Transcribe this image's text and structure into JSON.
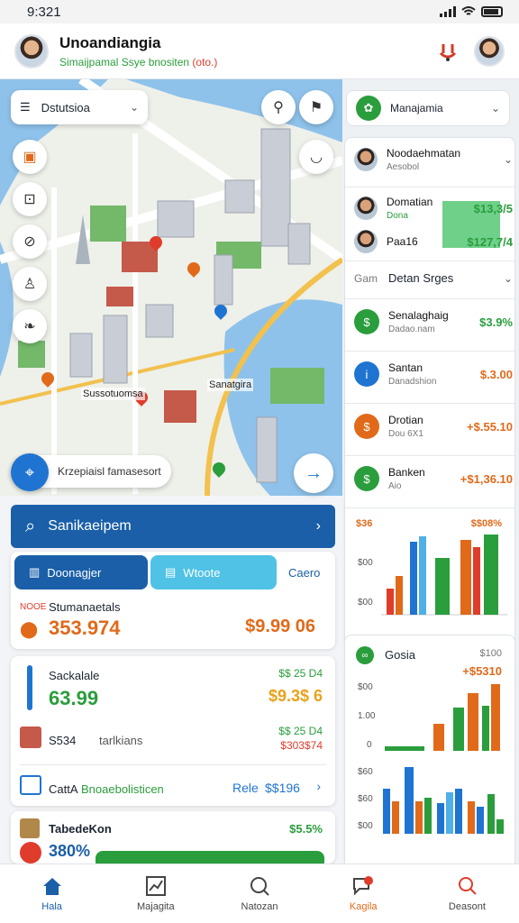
{
  "status": {
    "time": "9:321"
  },
  "header": {
    "title": "Unoandiangia",
    "subtitle": "Simaijpamal Ssye bnositen",
    "subtitle_tag": "(oto.)"
  },
  "map": {
    "dropdown_label": "Dstutsioa",
    "label_left": "Sussotuomsa",
    "label_right": "Sanatgira",
    "bottom_text": "Krzepiaisl famasesort"
  },
  "right_panel": {
    "card1_title": "Manajamia",
    "contact_main": {
      "name": "Noodaehmatan",
      "sub": "Aesobol"
    },
    "contacts": [
      {
        "name": "Domatian",
        "sub": "Dona",
        "value": "$13,3/5"
      },
      {
        "name": "Paa16",
        "sub": "",
        "value": "$127,7/4"
      }
    ],
    "section_prefix": "Gam",
    "section_title": "Detan Srges",
    "list": [
      {
        "name": "Senalaghaig",
        "sub": "Dadao.nam",
        "value": "$3.9%",
        "color": "#2a9d3c"
      },
      {
        "name": "Santan",
        "sub": "Danadshion",
        "value": "$.3.00",
        "color": "#1f74d1"
      },
      {
        "name": "Drotian",
        "sub": "Dou 6X1",
        "value": "+$.55.10",
        "color": "#e06a1a"
      },
      {
        "name": "Banken",
        "sub": "Aio",
        "value": "+$1,36.10",
        "color": "#2a9d3c"
      }
    ],
    "chart1": {
      "left_label": "$36",
      "right_label": "$$08%",
      "ticks": [
        "$00",
        "$00"
      ]
    },
    "chart2": {
      "title": "Gosia",
      "corner": "$100",
      "value": "+$5310",
      "ticks": [
        "$00",
        "1.00",
        "0"
      ]
    },
    "chart3": {
      "ticks": [
        "$60",
        "$60",
        "$00"
      ]
    }
  },
  "main": {
    "search_label": "Sanikaeipem",
    "tabs": [
      "Doonagjer",
      "Wtoote",
      "Caero"
    ],
    "card1": {
      "tag": "NOOE",
      "title": "Stumanaetals",
      "amount": "353.974",
      "value": "$9.99 06"
    },
    "card2": {
      "title": "Sackalale",
      "amount": "63.99",
      "right_top": "$$ 25 D4",
      "right_value": "$9.3$ 6",
      "row2_label": "S534",
      "row2_link": "tarlkians",
      "row2_val1": "$$ 25 D4",
      "row2_val2": "$303$74",
      "row3_label": "CattA",
      "row3_label2": "Bnoaebolisticen",
      "row3_link": "Rele",
      "row3_value": "$$196"
    },
    "card3": {
      "title": "TabedeKon",
      "value": "$5.5%",
      "amount": "380%"
    }
  },
  "bottom_nav": [
    {
      "label": "Hala",
      "icon": "home-icon"
    },
    {
      "label": "Majagita",
      "icon": "chart-icon"
    },
    {
      "label": "Natozan",
      "icon": "search-icon"
    },
    {
      "label": "Kagila",
      "icon": "chat-icon"
    },
    {
      "label": "Deasont",
      "icon": "person-icon"
    }
  ],
  "colors": {
    "brand_blue": "#1a5fa8",
    "green": "#2a9d3c",
    "orange": "#e06a1a",
    "red": "#e03c2c"
  }
}
